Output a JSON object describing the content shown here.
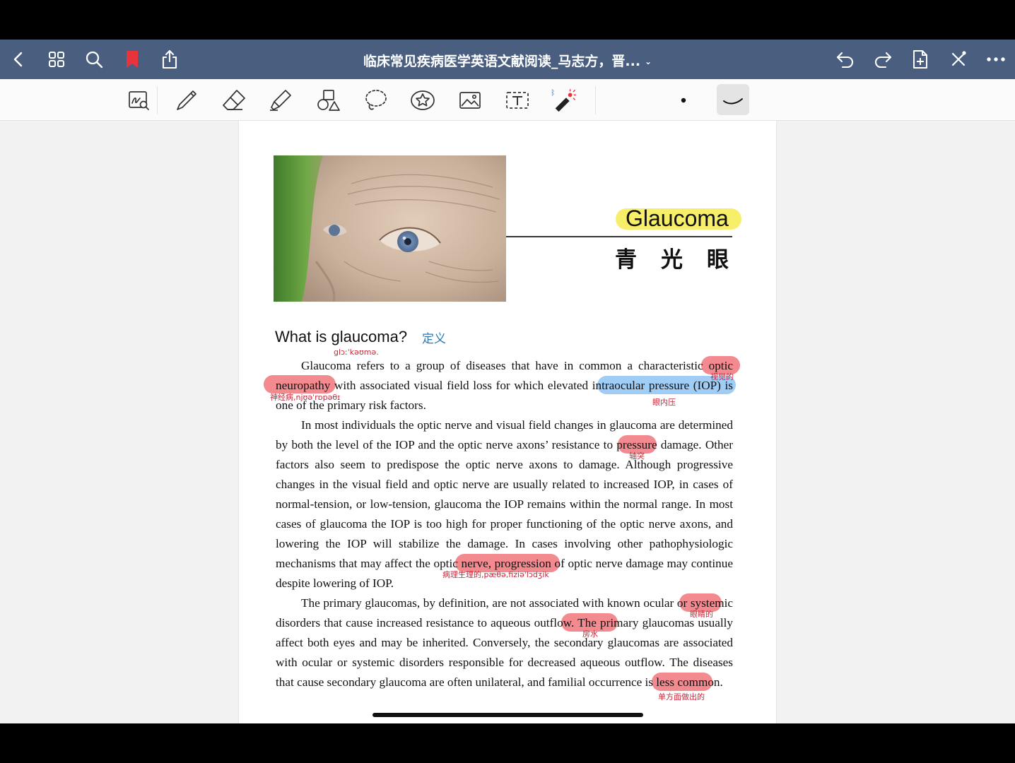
{
  "header": {
    "title": "临床常见疾病医学英语文献阅读_马志方，晋...",
    "icons": [
      "back-chevron-icon",
      "grid-icon",
      "search-icon",
      "bookmark-icon",
      "share-icon",
      "undo-icon",
      "redo-icon",
      "add-page-icon",
      "close-x-icon",
      "more-icon"
    ],
    "bookmark_color": "#e8323c",
    "bar_color": "#4a5f80"
  },
  "toolbar": {
    "tools": [
      "zoom-write-icon",
      "pen-icon",
      "eraser-icon",
      "highlighter-icon",
      "shapes-icon",
      "lasso-icon",
      "sticker-icon",
      "image-icon",
      "text-tool-icon",
      "laser-pointer-icon"
    ],
    "selected_tool": "stroke-style-icon"
  },
  "document": {
    "chapter_title": "Glaucoma",
    "chapter_subtitle": "青光眼",
    "section_heading": "What is glaucoma?",
    "paragraphs": [
      "Glaucoma refers to a group of diseases that have in common a characteristic optic neuropathy with associated visual field loss for which elevated intraocular pressure (IOP) is one of the primary risk factors.",
      "In most individuals the optic nerve and visual field changes in glaucoma are determined by both the level of the IOP and the optic nerve axons’ resistance to pressure damage. Other factors also seem to predispose the optic nerve axons to damage. Although progressive changes in the visual field and optic nerve are usually related to increased IOP, in cases of normal-tension, or low-tension, glaucoma the IOP remains within the normal range. In most cases of glaucoma the IOP is too high for proper functioning of the optic nerve axons, and lowering the IOP will stabilize the damage. In cases involving other pathophysiologic mechanisms that may affect the optic nerve, progression of optic nerve damage may continue despite lowering of IOP.",
      "The primary glaucomas, by definition, are not associated with known ocular or systemic disorders that cause increased resistance to aqueous outflow. The primary glaucomas usually affect both eyes and may be inherited. Conversely, the secondary glaucomas are associated with ocular or systemic disorders responsible for decreased aqueous outflow. The diseases that cause secondary glaucoma are often unilateral, and familial occurrence is less common."
    ]
  },
  "annotations": {
    "definition": "定义",
    "glaucoma_ipa": "glɔːˈkəʊmə.",
    "optic": "视觉的",
    "neuropathy": "神经病,njʊəˈrɒpəθɪ",
    "iop": "眼内压",
    "axons": "轴突",
    "pathophysiologic": "病理生理的,pæθə,fiziəˈlɔdʒik",
    "ocular": "眼睛的",
    "aqueous": "房水",
    "unilateral": "单方面做出的"
  }
}
